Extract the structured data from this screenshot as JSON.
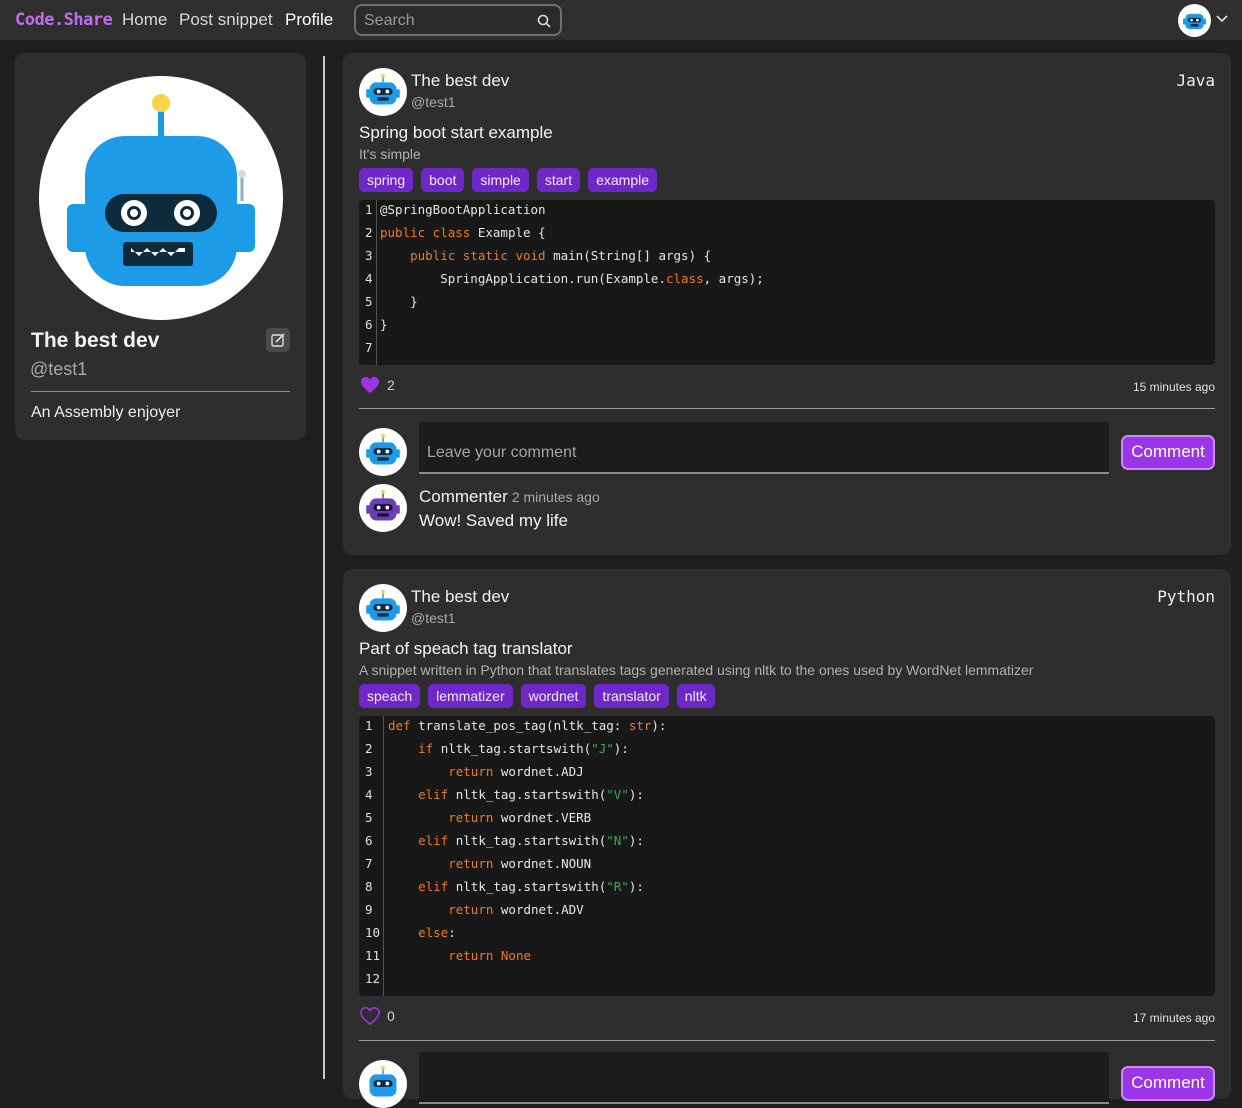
{
  "nav": {
    "brand": "Code.Share",
    "links": [
      "Home",
      "Post snippet",
      "Profile"
    ],
    "search_placeholder": "Search"
  },
  "profile": {
    "name": "The best dev",
    "handle": "@test1",
    "bio": "An Assembly enjoyer"
  },
  "colors": {
    "accent": "#9a35e8",
    "tag_bg": "#6f28c7",
    "brand": "#c06cf0",
    "keyword": "#f07a1e",
    "string": "#3ea84a"
  },
  "posts": [
    {
      "author": "The best dev",
      "handle": "@test1",
      "language": "Java",
      "title": "Spring boot start example",
      "description": "It's simple",
      "tags": [
        "spring",
        "boot",
        "simple",
        "start",
        "example"
      ],
      "code_lines": [
        "@SpringBootApplication",
        "public class Example {",
        "    public static void main(String[] args) {",
        "        SpringApplication.run(Example.class, args);",
        "    }",
        "}",
        ""
      ],
      "likes": "2",
      "liked": true,
      "time": "15 minutes ago",
      "comment_placeholder": "Leave your comment",
      "comment_button": "Comment",
      "comments": [
        {
          "author": "Commenter",
          "time": "2 minutes ago",
          "text": "Wow! Saved my life"
        }
      ]
    },
    {
      "author": "The best dev",
      "handle": "@test1",
      "language": "Python",
      "title": "Part of speach tag translator",
      "description": "A snippet written in Python that translates tags generated using nltk to the ones used by WordNet lemmatizer",
      "tags": [
        "speach",
        "lemmatizer",
        "wordnet",
        "translator",
        "nltk"
      ],
      "code_lines": [
        "def translate_pos_tag(nltk_tag: str):",
        "    if nltk_tag.startswith(\"J\"):",
        "        return wordnet.ADJ",
        "    elif nltk_tag.startswith(\"V\"):",
        "        return wordnet.VERB",
        "    elif nltk_tag.startswith(\"N\"):",
        "        return wordnet.NOUN",
        "    elif nltk_tag.startswith(\"R\"):",
        "        return wordnet.ADV",
        "    else:",
        "        return None",
        ""
      ],
      "likes": "0",
      "liked": false,
      "time": "17 minutes ago",
      "comment_button": "Comment"
    }
  ]
}
